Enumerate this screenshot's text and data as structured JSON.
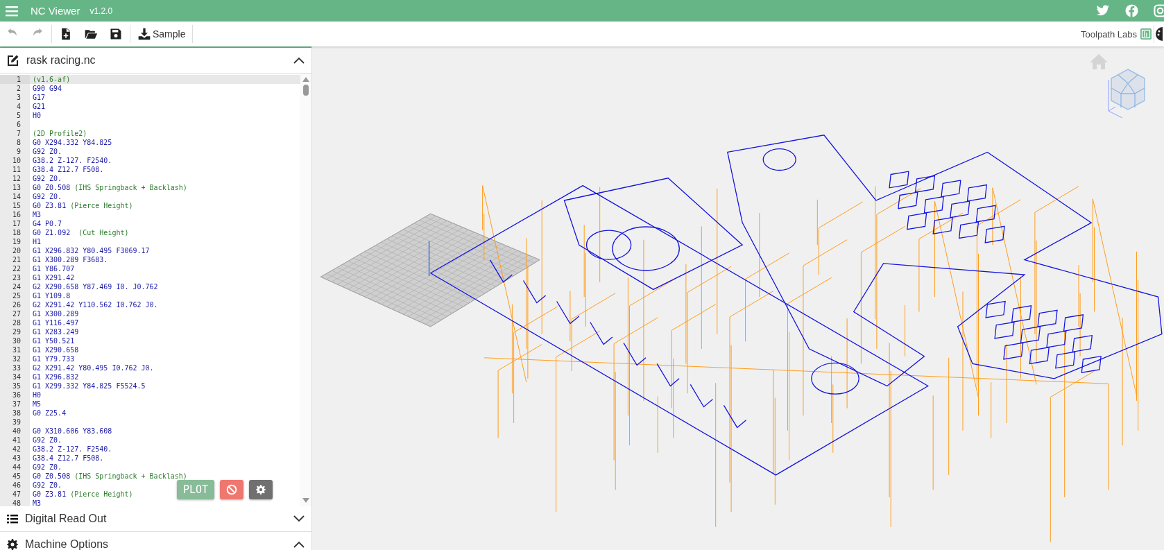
{
  "app": {
    "title": "NC Viewer",
    "version": "v1.2.0"
  },
  "tools": [
    {
      "kind": "undo",
      "disabled": true
    },
    {
      "kind": "redo",
      "disabled": true
    },
    {
      "kind": "new",
      "disabled": false
    },
    {
      "kind": "open",
      "disabled": false
    },
    {
      "kind": "save",
      "disabled": false
    },
    {
      "kind": "sample",
      "label": "Sample",
      "disabled": false
    }
  ],
  "brand": "Toolpath Labs",
  "editor": {
    "filename": "rask racing.nc",
    "expanded": true,
    "lines": [
      {
        "number": "1",
        "comment": "(v1.6-af)",
        "selected": true
      },
      {
        "number": "2",
        "code": "G90 G94",
        "selected": false
      },
      {
        "number": "3",
        "code": "G17",
        "selected": false
      },
      {
        "number": "4",
        "code": "G21",
        "selected": false
      },
      {
        "number": "5",
        "code": "H0",
        "selected": false
      },
      {
        "number": "6",
        "selected": false
      },
      {
        "number": "7",
        "comment": "(2D Profile2)",
        "selected": false
      },
      {
        "number": "8",
        "code": "G0 X294.332 Y84.825",
        "selected": false
      },
      {
        "number": "9",
        "code": "G92 Z0.",
        "selected": false
      },
      {
        "number": "10",
        "code": "G38.2 Z-127. F2540.",
        "selected": false
      },
      {
        "number": "11",
        "code": "G38.4 Z12.7 F508.",
        "selected": false
      },
      {
        "number": "12",
        "code": "G92 Z0.",
        "selected": false
      },
      {
        "number": "13",
        "code": "G0 Z0.508",
        "comment": "(IHS Springback + Backlash)",
        "selected": false
      },
      {
        "number": "14",
        "code": "G92 Z0.",
        "selected": false
      },
      {
        "number": "15",
        "code": "G0 Z3.81",
        "comment": "(Pierce Height)",
        "selected": false
      },
      {
        "number": "16",
        "code": "M3",
        "selected": false
      },
      {
        "number": "17",
        "code": "G4 P0.7",
        "selected": false
      },
      {
        "number": "18",
        "code": "G0 Z1.092 ",
        "comment": "(Cut Height)",
        "selected": false
      },
      {
        "number": "19",
        "code": "H1",
        "selected": false
      },
      {
        "number": "20",
        "code": "G1 X296.832 Y80.495 F3069.17",
        "selected": false
      },
      {
        "number": "21",
        "code": "G1 X300.289 F3683.",
        "selected": false
      },
      {
        "number": "22",
        "code": "G1 Y86.707",
        "selected": false
      },
      {
        "number": "23",
        "code": "G1 X291.42",
        "selected": false
      },
      {
        "number": "24",
        "code": "G2 X290.658 Y87.469 I0. J0.762",
        "selected": false
      },
      {
        "number": "25",
        "code": "G1 Y109.8",
        "selected": false
      },
      {
        "number": "26",
        "code": "G2 X291.42 Y110.562 I0.762 J0.",
        "selected": false
      },
      {
        "number": "27",
        "code": "G1 X300.289",
        "selected": false
      },
      {
        "number": "28",
        "code": "G1 Y116.497",
        "selected": false
      },
      {
        "number": "29",
        "code": "G1 X283.249",
        "selected": false
      },
      {
        "number": "30",
        "code": "G1 Y50.521",
        "selected": false
      },
      {
        "number": "31",
        "code": "G1 X290.658",
        "selected": false
      },
      {
        "number": "32",
        "code": "G1 Y79.733",
        "selected": false
      },
      {
        "number": "33",
        "code": "G2 X291.42 Y80.495 I0.762 J0.",
        "selected": false
      },
      {
        "number": "34",
        "code": "G1 X296.832",
        "selected": false
      },
      {
        "number": "35",
        "code": "G1 X299.332 Y84.825 F5524.5",
        "selected": false
      },
      {
        "number": "36",
        "code": "H0",
        "selected": false
      },
      {
        "number": "37",
        "code": "M5",
        "selected": false
      },
      {
        "number": "38",
        "code": "G0 Z25.4",
        "selected": false
      },
      {
        "number": "39",
        "selected": false
      },
      {
        "number": "40",
        "code": "G0 X310.606 Y83.608",
        "selected": false
      },
      {
        "number": "41",
        "code": "G92 Z0.",
        "selected": false
      },
      {
        "number": "42",
        "code": "G38.2 Z-127. F2540.",
        "selected": false
      },
      {
        "number": "43",
        "code": "G38.4 Z12.7 F508.",
        "selected": false
      },
      {
        "number": "44",
        "code": "G92 Z0.",
        "selected": false
      },
      {
        "number": "45",
        "code": "G0 Z0.508",
        "comment": "(IHS Springback + Backlash)",
        "selected": false
      },
      {
        "number": "46",
        "code": "G92 Z0.",
        "selected": false
      },
      {
        "number": "47",
        "code": "G0 Z3.81",
        "comment": "(Pierce Height)",
        "selected": false
      },
      {
        "number": "48",
        "code": "M3",
        "selected": false
      }
    ]
  },
  "actions": [
    {
      "kind": "plot",
      "label": "PLOT"
    },
    {
      "kind": "stop"
    },
    {
      "kind": "settings"
    }
  ],
  "panels": [
    {
      "kind": "list",
      "title": "Digital Read Out",
      "expanded": false
    },
    {
      "kind": "gear",
      "title": "Machine Options",
      "expanded": true
    }
  ]
}
